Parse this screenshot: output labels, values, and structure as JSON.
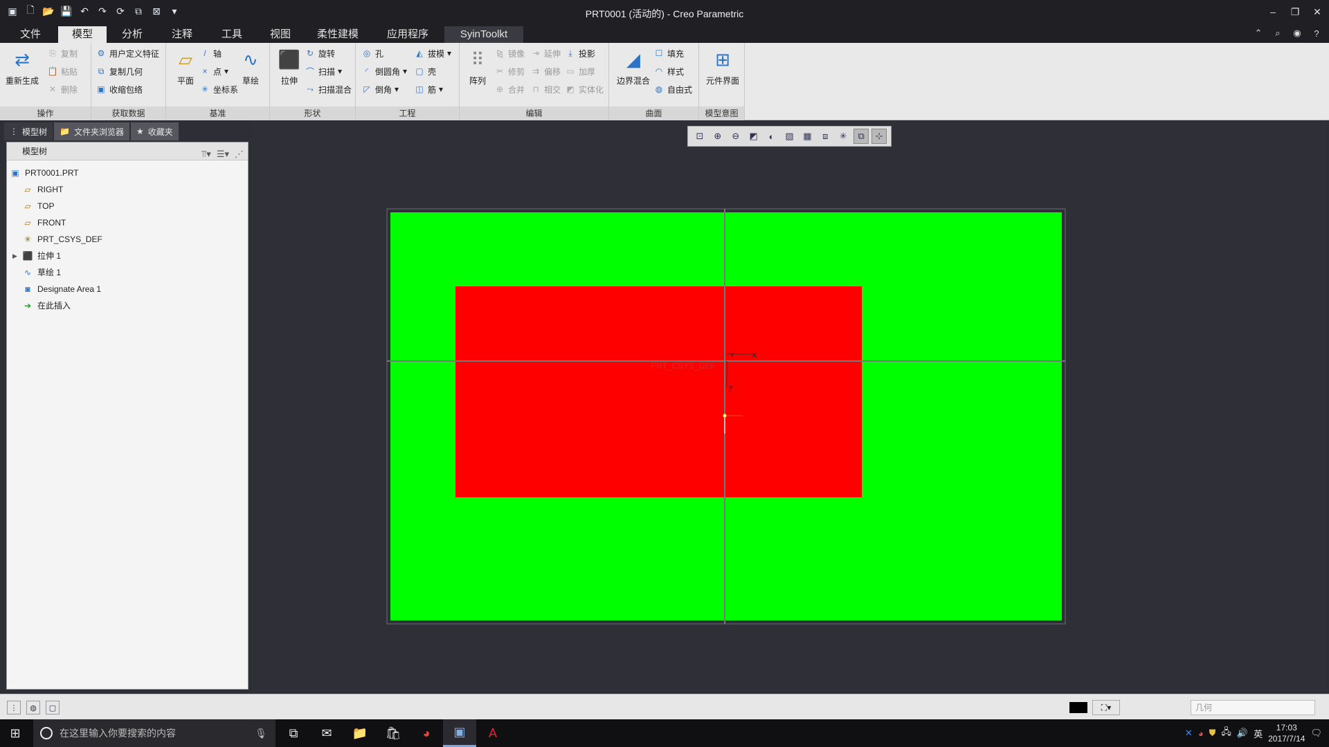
{
  "window": {
    "title": "PRT0001 (活动的) - Creo Parametric"
  },
  "tabs": [
    {
      "label": "文件"
    },
    {
      "label": "模型"
    },
    {
      "label": "分析"
    },
    {
      "label": "注释"
    },
    {
      "label": "工具"
    },
    {
      "label": "视图"
    },
    {
      "label": "柔性建模"
    },
    {
      "label": "应用程序"
    },
    {
      "label": "SyinToolkt"
    }
  ],
  "ribbon": {
    "operations": {
      "regen": "重新生成",
      "copy": "复制",
      "paste": "粘贴",
      "delete": "删除",
      "label": "操作"
    },
    "get_data": {
      "udf": "用户定义特征",
      "copy_geom": "复制几何",
      "shrinkwrap": "收缩包络",
      "label": "获取数据"
    },
    "datum": {
      "plane": "平面",
      "axis": "轴",
      "point": "点",
      "csys": "坐标系",
      "sketch": "草绘",
      "label": "基准"
    },
    "shapes": {
      "extrude": "拉伸",
      "revolve": "旋转",
      "sweep": "扫描",
      "swept_blend": "扫描混合",
      "label": "形状"
    },
    "engineering": {
      "hole": "孔",
      "round": "倒圆角",
      "chamfer": "倒角",
      "draft": "拔模",
      "shell": "壳",
      "rib": "筋",
      "label": "工程"
    },
    "editing": {
      "pattern": "阵列",
      "mirror": "镜像",
      "trim": "修剪",
      "merge": "合并",
      "extend": "延伸",
      "offset": "偏移",
      "intersect": "相交",
      "project": "投影",
      "thicken": "加厚",
      "solidify": "实体化",
      "label": "编辑"
    },
    "surfaces": {
      "boundary_blend": "边界混合",
      "fill": "填充",
      "style": "样式",
      "freestyle": "自由式",
      "label": "曲面"
    },
    "model_intent": {
      "component_interface": "元件界面",
      "label": "模型意图"
    }
  },
  "left_panel": {
    "tabs": [
      {
        "label": "模型树"
      },
      {
        "label": "文件夹浏览器"
      },
      {
        "label": "收藏夹"
      }
    ],
    "tree_header": "模型树",
    "tree_items": [
      {
        "label": "PRT0001.PRT"
      },
      {
        "label": "RIGHT"
      },
      {
        "label": "TOP"
      },
      {
        "label": "FRONT"
      },
      {
        "label": "PRT_CSYS_DEF"
      },
      {
        "label": "拉伸 1"
      },
      {
        "label": "草绘 1"
      },
      {
        "label": "Designate Area 1"
      },
      {
        "label": "在此插入"
      }
    ]
  },
  "viewport": {
    "csys_label": "PRT_CSYS_DEF",
    "axis_x": "X",
    "axis_y": "Y",
    "axis_z": "Z",
    "colors": {
      "outer_plate": "#00ff00",
      "inner_region": "#ff0000",
      "background": "#2e2f37"
    }
  },
  "status_bar": {
    "selection_filter_placeholder": "几何"
  },
  "taskbar": {
    "search_placeholder": "在这里输入你要搜索的内容",
    "ime": "英",
    "time": "17:03",
    "date": "2017/7/14"
  }
}
